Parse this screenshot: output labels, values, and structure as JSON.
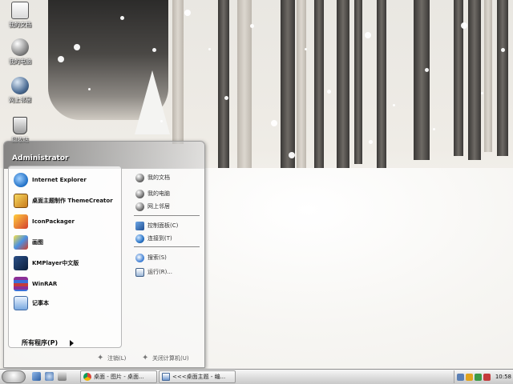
{
  "desktop": {
    "icons": [
      {
        "label": "我的文档",
        "icon": "documents-icon"
      },
      {
        "label": "我的电脑",
        "icon": "computer-icon"
      },
      {
        "label": "网上邻居",
        "icon": "network-icon"
      },
      {
        "label": "回收站",
        "icon": "recycle-bin-icon"
      }
    ]
  },
  "start_menu": {
    "user": "Administrator",
    "programs": [
      {
        "label": "Internet Explorer",
        "icon": "internet-explorer-icon"
      },
      {
        "label": "桌面主题制作 ThemeCreator",
        "icon": "theme-creator-icon"
      },
      {
        "label": "IconPackager",
        "icon": "iconpackager-icon"
      },
      {
        "label": "画图",
        "icon": "paint-icon"
      },
      {
        "label": "KMPlayer中文版",
        "icon": "kmplayer-icon"
      },
      {
        "label": "WinRAR",
        "icon": "winrar-icon"
      },
      {
        "label": "记事本",
        "icon": "notepad-icon"
      }
    ],
    "all_programs": "所有程序(P)",
    "places": [
      {
        "label": "我的文档",
        "icon": "documents-icon"
      },
      {
        "label": "我的电脑",
        "icon": "computer-icon"
      },
      {
        "label": "网上邻居",
        "icon": "network-icon"
      }
    ],
    "system": [
      {
        "label": "控制面板(C)",
        "icon": "control-panel-icon"
      },
      {
        "label": "连接到(T)",
        "icon": "connect-to-icon"
      }
    ],
    "actions": [
      {
        "label": "搜索(S)",
        "icon": "search-icon"
      },
      {
        "label": "运行(R)...",
        "icon": "run-icon"
      }
    ],
    "footer": {
      "logoff": "注销(L)",
      "shutdown": "关闭计算机(U)"
    }
  },
  "taskbar": {
    "tasks": [
      {
        "label": "桌面 - 图片 - 桌面...",
        "icon": "chrome-icon"
      },
      {
        "label": "<<<桌面主题 - 编...",
        "icon": "window-icon"
      }
    ],
    "clock": "10:58"
  },
  "colors": {
    "taskbar_top": "#f7f7f7",
    "taskbar_bottom": "#c9c9c9",
    "menu_panel": "#ffffff"
  }
}
